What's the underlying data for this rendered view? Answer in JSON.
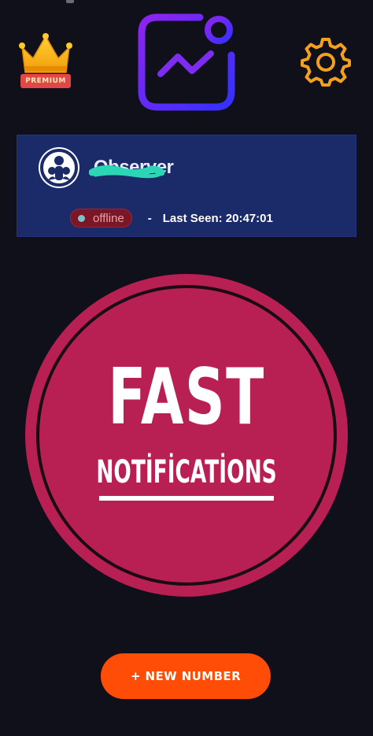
{
  "header": {
    "premium_label": "PREMIUM"
  },
  "contact": {
    "name": "Observer",
    "status": "offline",
    "separator": "-",
    "last_seen": "Last Seen: 20:47:01"
  },
  "hero": {
    "title": "FAST",
    "subtitle": "NOTİFİCATİONS"
  },
  "actions": {
    "new_number_label": "+ NEW NUMBER"
  },
  "icons": {
    "premium": "crown-icon",
    "logo": "app-logo-icon",
    "settings": "gear-icon",
    "avatar": "contact-avatar-icon"
  },
  "colors": {
    "background": "#10101b",
    "card": "#1b2a68",
    "status_pill": "#7a1626",
    "hero_circle": "#b81f52",
    "primary_button": "#ff4d08",
    "crown": "#f7b30a",
    "gear": "#f2a01e",
    "logo_gradient_start": "#7e22f2",
    "logo_gradient_end": "#3a2cff"
  }
}
